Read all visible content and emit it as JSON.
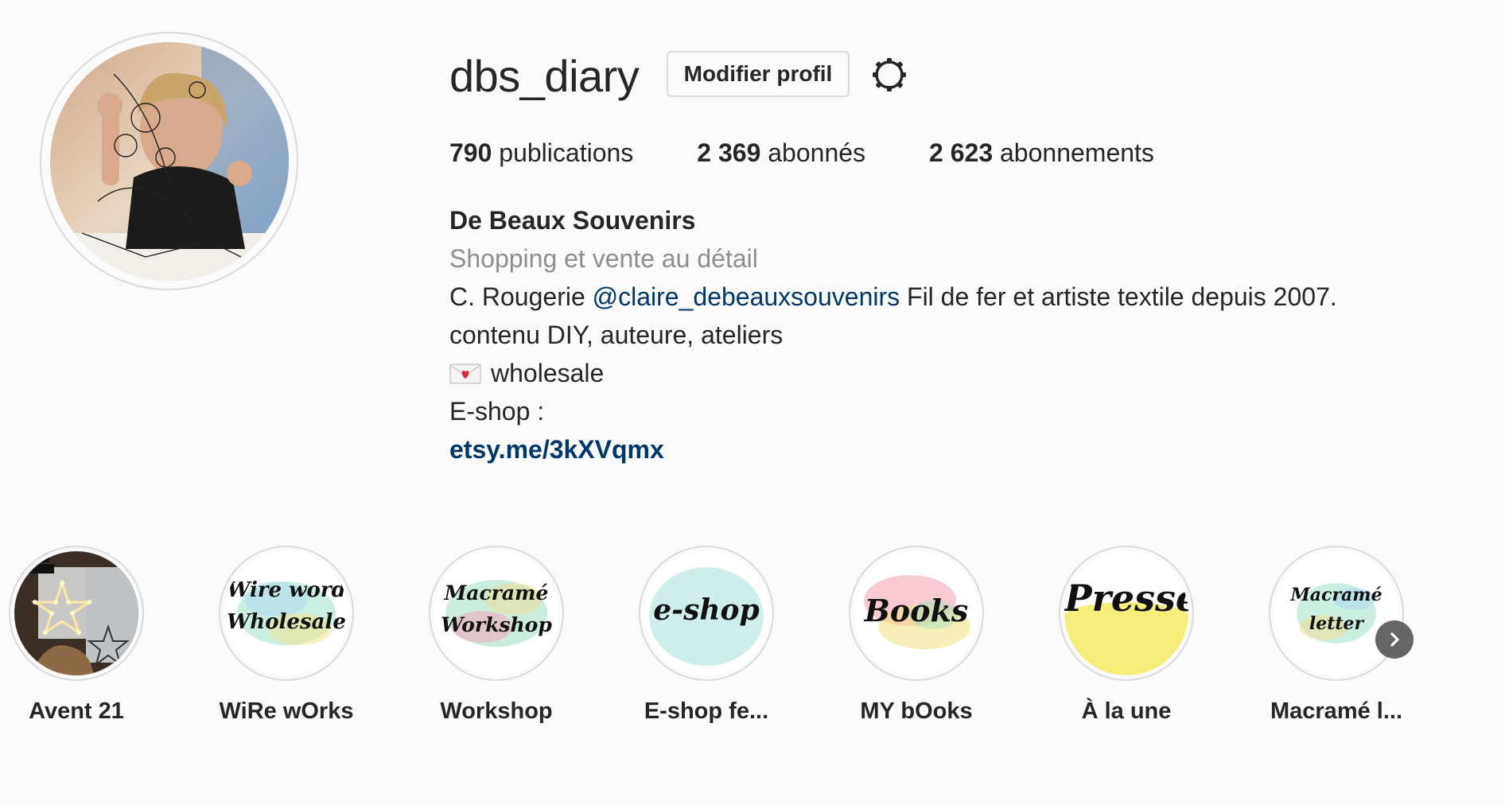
{
  "profile": {
    "username": "dbs_diary",
    "edit_label": "Modifier profil",
    "settings_icon": "settings-gear-icon"
  },
  "stats": [
    {
      "count": "790",
      "label": "publications"
    },
    {
      "count": "2 369",
      "label": "abonnés"
    },
    {
      "count": "2 623",
      "label": "abonnements"
    }
  ],
  "bio": {
    "name": "De Beaux Souvenirs",
    "category": "Shopping et vente au détail",
    "line1_prefix": "C. Rougerie ",
    "line1_mention": "@claire_debeauxsouvenirs",
    "line1_suffix": " Fil de fer et artiste textile depuis 2007.",
    "line2": "contenu DIY, auteure, ateliers",
    "line3_icon": "love-letter-icon",
    "line3": "wholesale",
    "line4": "E-shop :",
    "link": "etsy.me/3kXVqmx"
  },
  "highlights": [
    {
      "label": "Avent 21",
      "cover_text": ""
    },
    {
      "label": "WiRe wOrks",
      "cover_text_1": "Wire word",
      "cover_text_2": "Wholesale"
    },
    {
      "label": "Workshop",
      "cover_text_1": "Macramé",
      "cover_text_2": "Workshop"
    },
    {
      "label": "E-shop fe...",
      "cover_text_1": "e-shop"
    },
    {
      "label": "MY bOoks",
      "cover_text_1": "Books"
    },
    {
      "label": "À la une",
      "cover_text_1": "Presse"
    },
    {
      "label": "Macramé l...",
      "cover_text_1": "Macramé",
      "cover_text_2": "letter"
    }
  ],
  "colors": {
    "link": "#00376b",
    "secondary": "#8e8e8e",
    "border": "#dbdbdb"
  }
}
